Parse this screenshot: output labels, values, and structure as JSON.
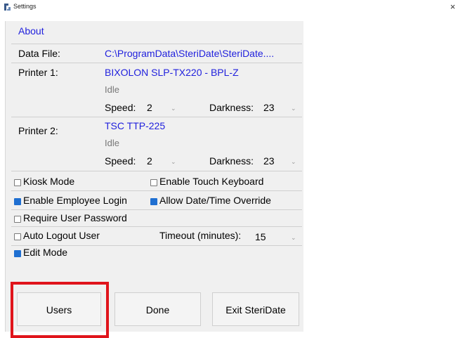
{
  "window": {
    "title": "Settings",
    "close_glyph": "×"
  },
  "about_link": "About",
  "data_file": {
    "label": "Data File:",
    "value": "C:\\ProgramData\\SteriDate\\SteriDate...."
  },
  "printer1": {
    "label": "Printer 1:",
    "name": "BIXOLON SLP-TX220 - BPL-Z",
    "status": "Idle",
    "speed_label": "Speed:",
    "speed_value": "2",
    "darkness_label": "Darkness:",
    "darkness_value": "23"
  },
  "printer2": {
    "label": "Printer 2:",
    "name": "TSC TTP-225",
    "status": "Idle",
    "speed_label": "Speed:",
    "speed_value": "2",
    "darkness_label": "Darkness:",
    "darkness_value": "23"
  },
  "options": {
    "kiosk_mode": {
      "label": "Kiosk Mode",
      "checked": false
    },
    "touch_keyboard": {
      "label": "Enable Touch Keyboard",
      "checked": false
    },
    "employee_login": {
      "label": "Enable Employee Login",
      "checked": true
    },
    "date_override": {
      "label": "Allow Date/Time Override",
      "checked": true
    },
    "require_password": {
      "label": "Require User Password",
      "checked": false
    },
    "auto_logout": {
      "label": "Auto Logout User",
      "checked": false
    },
    "timeout_label": "Timeout (minutes):",
    "timeout_value": "15",
    "edit_mode": {
      "label": "Edit Mode",
      "checked": true
    }
  },
  "buttons": {
    "users": "Users",
    "done": "Done",
    "exit": "Exit SteriDate"
  },
  "colors": {
    "link_blue": "#2121dd",
    "check_blue": "#1f6fd1",
    "highlight_red": "#e0141b"
  },
  "icons": {
    "app": "steridate-app-icon",
    "dropdown": "chevron-down-icon"
  }
}
